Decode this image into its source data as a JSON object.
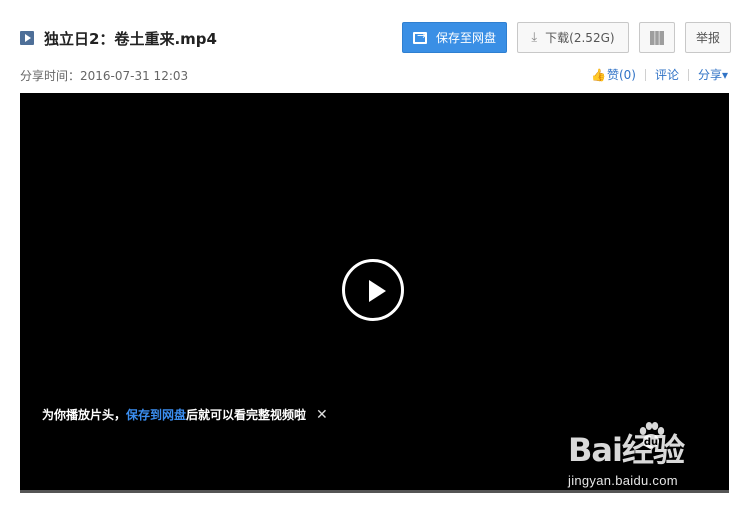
{
  "file": {
    "title": "独立日2：卷土重来.mp4",
    "icon": "video-file-icon"
  },
  "toolbar": {
    "save_label": "保存至网盘",
    "download_label": "下载(2.52G)",
    "report_label": "举报",
    "save_icon": "save-to-cloud-icon",
    "download_icon": "download-icon",
    "qr_icon": "qr-code-icon"
  },
  "meta": {
    "share_time": "分享时间：2016-07-31 12:03"
  },
  "actions": {
    "like": "赞(0)",
    "comment": "评论",
    "share": "分享▾"
  },
  "player": {
    "tip_prefix": "为你播放片头，",
    "tip_link": "保存到网盘",
    "tip_suffix": "后就可以看完整视频啦",
    "tip_close": "✕"
  },
  "watermark": {
    "brand": "Bai经验",
    "url": "jingyan.baidu.com"
  },
  "colors": {
    "accent": "#3a8fe5",
    "link": "#3173c6"
  }
}
